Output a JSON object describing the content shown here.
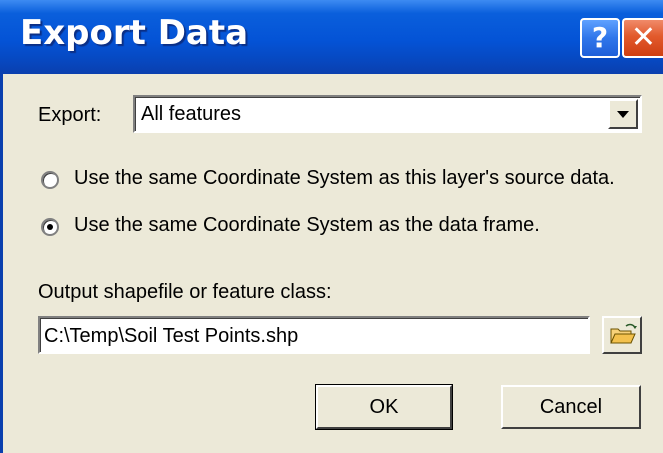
{
  "window": {
    "title": "Export Data",
    "help_symbol": "?",
    "close_symbol": "✕"
  },
  "export": {
    "label": "Export:",
    "selected_value": "All features"
  },
  "coordinate_options": [
    {
      "label": "Use the same Coordinate System as this layer's source data.",
      "checked": false
    },
    {
      "label": "Use the same Coordinate System as the data frame.",
      "checked": true
    }
  ],
  "output": {
    "label": "Output shapefile or feature class:",
    "value": "C:\\Temp\\Soil Test Points.shp"
  },
  "buttons": {
    "ok_label": "OK",
    "cancel_label": "Cancel"
  },
  "colors": {
    "titlebar": "#0453d6",
    "dialog_bg": "#ece9d8",
    "close_button": "#e25a2c"
  },
  "icons": {
    "browse": "open-folder-icon",
    "dropdown": "chevron-down-icon"
  }
}
